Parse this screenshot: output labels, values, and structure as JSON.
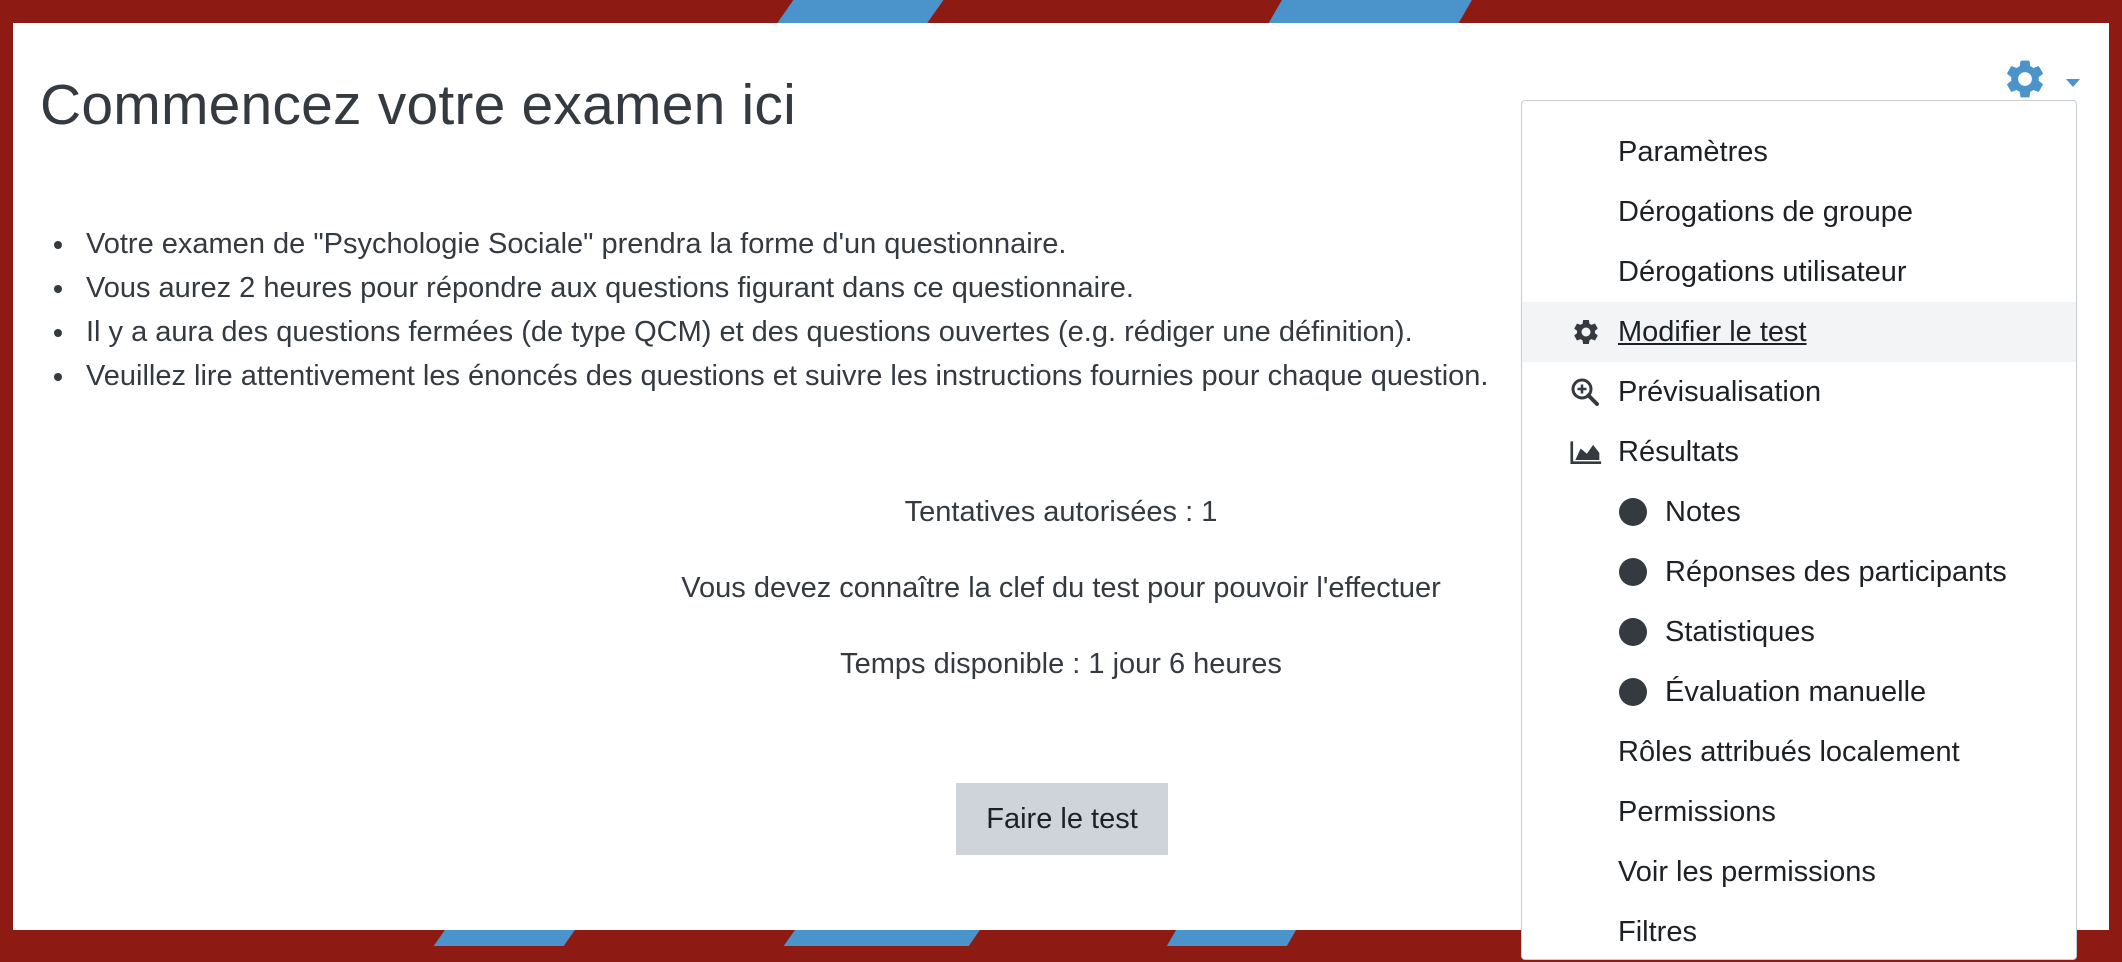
{
  "page": {
    "title": "Commencez votre examen ici",
    "intro_items": [
      "Votre examen de \"Psychologie Sociale\" prendra la forme d'un questionnaire.",
      "Vous aurez 2 heures pour répondre aux questions figurant dans ce questionnaire.",
      "Il y a aura des questions fermées (de type QCM) et des questions ouvertes (e.g. rédiger une définition).",
      "Veuillez lire attentivement les énoncés des questions et suivre les instructions fournies pour chaque question."
    ],
    "attempts_allowed": "Tentatives autorisées : 1",
    "password_notice": "Vous devez connaître la clef du test pour pouvoir l'effectuer",
    "time_limit": "Temps disponible : 1 jour 6 heures",
    "attempt_button": "Faire le test"
  },
  "menu": {
    "toggle_icon": "gear-icon",
    "items": [
      {
        "label": "Paramètres",
        "icon": null
      },
      {
        "label": "Dérogations de groupe",
        "icon": null
      },
      {
        "label": "Dérogations utilisateur",
        "icon": null
      },
      {
        "label": "Modifier le test",
        "icon": "gear-icon",
        "active": true
      },
      {
        "label": "Prévisualisation",
        "icon": "magnifier-plus-icon"
      },
      {
        "label": "Résultats",
        "icon": "area-chart-icon"
      },
      {
        "label": "Notes",
        "icon": "bullet-dot-icon",
        "sub": true
      },
      {
        "label": "Réponses des participants",
        "icon": "bullet-dot-icon",
        "sub": true
      },
      {
        "label": "Statistiques",
        "icon": "bullet-dot-icon",
        "sub": true
      },
      {
        "label": "Évaluation manuelle",
        "icon": "bullet-dot-icon",
        "sub": true
      },
      {
        "label": "Rôles attribués localement",
        "icon": null
      },
      {
        "label": "Permissions",
        "icon": null
      },
      {
        "label": "Voir les permissions",
        "icon": null
      },
      {
        "label": "Filtres",
        "icon": null
      }
    ]
  },
  "colors": {
    "background_red": "#8e1a14",
    "accent_blue": "#4a94cb",
    "text": "#343a40",
    "button_bg": "#ced4da",
    "active_item_bg": "#f3f4f6"
  }
}
